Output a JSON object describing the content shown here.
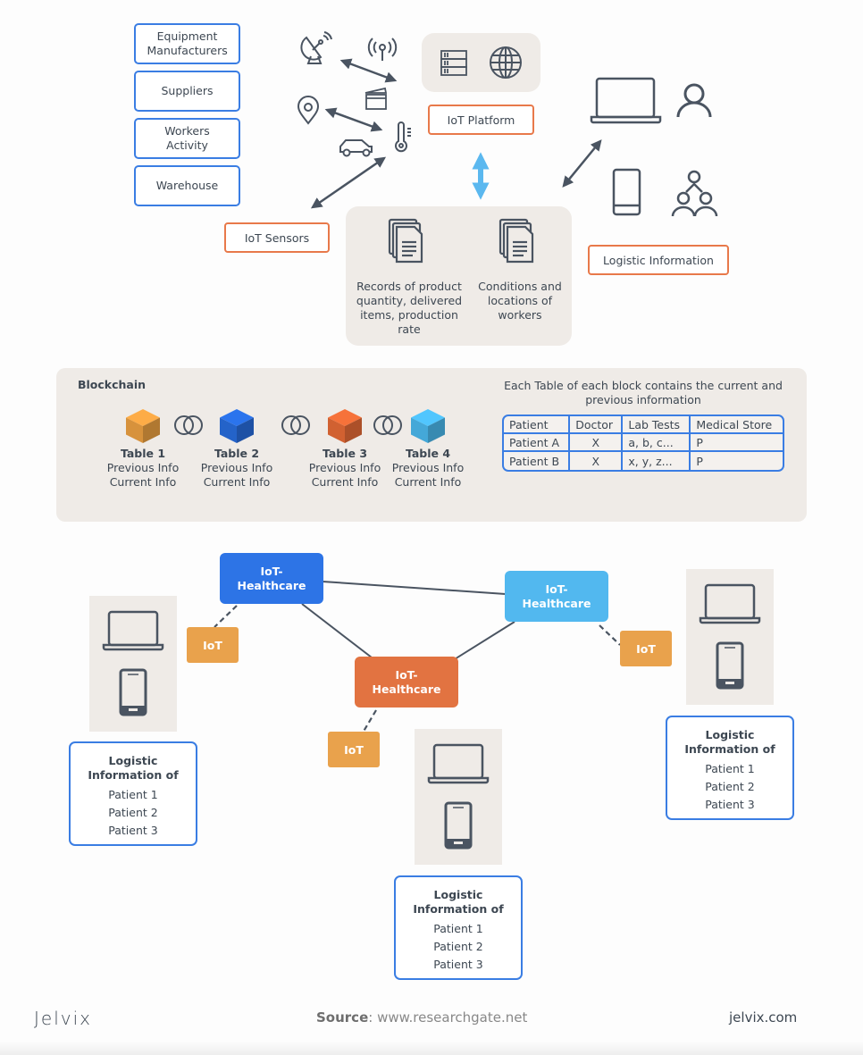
{
  "top": {
    "stakeholders": [
      "Equipment Manufacturers",
      "Suppliers",
      "Workers Activity",
      "Warehouse"
    ],
    "sensor_icons": [
      "satellite-dish-icon",
      "wireless-signal-icon",
      "clapperboard-icon",
      "location-pin-icon",
      "car-icon",
      "thermometer-icon"
    ],
    "iot_sensors_label": "IoT Sensors",
    "iot_platform_label": "IoT Platform",
    "platform_icons": [
      "server-icon",
      "globe-icon"
    ],
    "records": [
      {
        "icon": "documents-icon",
        "text": "Records of product quantity, delivered items, production rate"
      },
      {
        "icon": "documents-icon",
        "text": "Conditions and locations of workers"
      }
    ],
    "logistic_information_label": "Logistic Information",
    "user_icons": [
      "laptop-icon",
      "user-icon",
      "smartphone-icon",
      "group-icon"
    ]
  },
  "blockchain": {
    "title": "Blockchain",
    "blocks": [
      {
        "name": "Table 1",
        "line1": "Previous Info",
        "line2": "Current Info",
        "color": "#e29a3f"
      },
      {
        "name": "Table 2",
        "line1": "Previous Info",
        "line2": "Current Info",
        "color": "#2668d4"
      },
      {
        "name": "Table 3",
        "line1": "Previous Info",
        "line2": "Current Info",
        "color": "#dc6634"
      },
      {
        "name": "Table 4",
        "line1": "Previous Info",
        "line2": "Current Info",
        "color": "#48b1e3"
      }
    ],
    "table_caption": "Each Table of each block contains the current and previous information",
    "table": {
      "headers": [
        "Patient",
        "Doctor",
        "Lab Tests",
        "Medical Store"
      ],
      "rows": [
        [
          "Patient A",
          "X",
          "a, b, c...",
          "P"
        ],
        [
          "Patient B",
          "X",
          "x, y, z...",
          "P"
        ]
      ]
    }
  },
  "network": {
    "nodes": [
      {
        "label": "IoT-\nHealthcare",
        "color": "#2d74e6"
      },
      {
        "label": "IoT-\nHealthcare",
        "color": "#52b8ef"
      },
      {
        "label": "IoT-\nHealthcare",
        "color": "#e27341"
      }
    ],
    "iot_label": "IoT",
    "logistic": {
      "title_line1": "Logistic",
      "title_line2": "Information of",
      "patients": [
        "Patient 1",
        "Patient 2",
        "Patient 3"
      ]
    }
  },
  "footer": {
    "brand": "Jelvix",
    "source_label": "Source",
    "source_value": ": www.researchgate.net",
    "site": "jelvix.com"
  },
  "colors": {
    "blue": "#3a7de3",
    "orange": "#e8794a",
    "beige": "#efebe7",
    "iot_orange": "#e9a24c",
    "text": "#3d4752",
    "arrow_light_blue": "#5bb8ef"
  }
}
